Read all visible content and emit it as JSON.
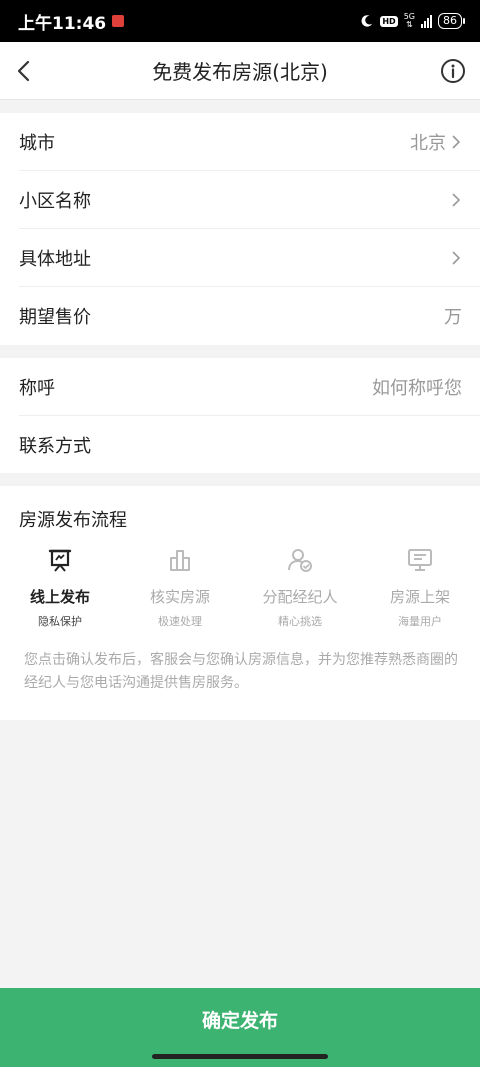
{
  "status_bar": {
    "time": "上午11:46",
    "network": "5G",
    "battery": "86"
  },
  "header": {
    "title": "免费发布房源(北京)"
  },
  "form1": [
    {
      "label": "城市",
      "value": "北京",
      "chevron": true
    },
    {
      "label": "小区名称",
      "value": "",
      "chevron": true
    },
    {
      "label": "具体地址",
      "value": "",
      "chevron": true
    },
    {
      "label": "期望售价",
      "value": "万",
      "chevron": false
    }
  ],
  "form2": [
    {
      "label": "称呼",
      "placeholder": "如何称呼您"
    },
    {
      "label": "联系方式",
      "placeholder": ""
    }
  ],
  "flow": {
    "title": "房源发布流程",
    "steps": [
      {
        "title": "线上发布",
        "subtitle": "隐私保护",
        "icon": "presentation-icon",
        "active": true
      },
      {
        "title": "核实房源",
        "subtitle": "极速处理",
        "icon": "building-icon",
        "active": false
      },
      {
        "title": "分配经纪人",
        "subtitle": "精心挑选",
        "icon": "user-check-icon",
        "active": false
      },
      {
        "title": "房源上架",
        "subtitle": "海量用户",
        "icon": "monitor-icon",
        "active": false
      }
    ],
    "description": "您点击确认发布后，客服会与您确认房源信息，并为您推荐熟悉商圈的经纪人与您电话沟通提供售房服务。"
  },
  "confirm_button": "确定发布",
  "colors": {
    "accent": "#3cb371",
    "text": "#222222",
    "muted": "#aaaaaa"
  }
}
